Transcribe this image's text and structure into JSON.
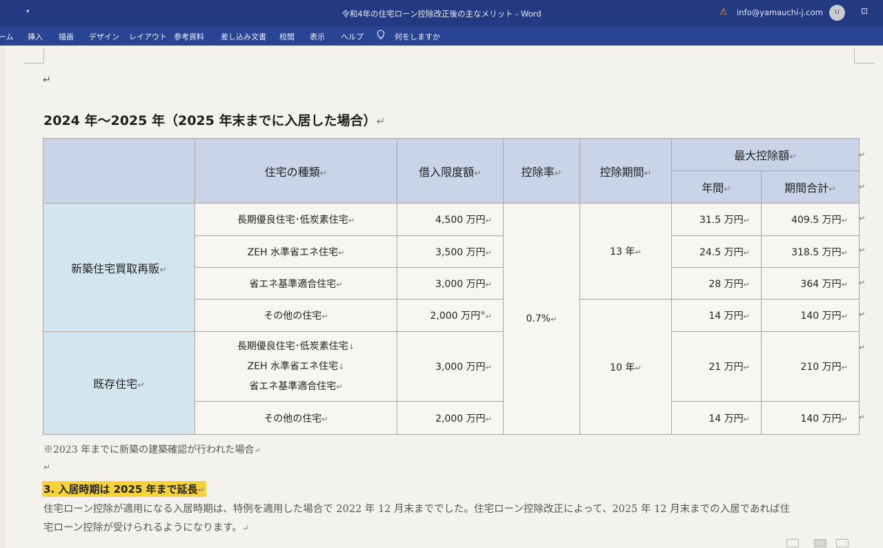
{
  "titlebar": {
    "quick_access": "▾",
    "title": "令和4年の住宅ローン控除改正後の主なメリット  -  Word",
    "account": "info@yamauchi-j.com",
    "avatar": "U"
  },
  "ribbon": {
    "tabs": [
      "ーム",
      "挿入",
      "描画",
      "デザイン",
      "レイアウト",
      "参考資料",
      "差し込み文書",
      "校閲",
      "表示",
      "ヘルプ"
    ],
    "tell_me": "何をしますか"
  },
  "document": {
    "heading": "2024 年〜2025 年（2025 年末までに入居した場合）",
    "table": {
      "headers": {
        "type": "住宅の種類",
        "limit": "借入限度額",
        "rate": "控除率",
        "period": "控除期間",
        "max": "最大控除額",
        "annual": "年間",
        "total": "期間合計"
      },
      "groups": {
        "new": "新築住宅買取再販",
        "existing": "既存住宅"
      },
      "rate_value": "0.7%",
      "period_13": "13 年",
      "period_10": "10 年",
      "rows": [
        {
          "type": "長期優良住宅･低炭素住宅",
          "limit": "4,500 万円",
          "annual": "31.5 万円",
          "total": "409.5 万円"
        },
        {
          "type": "ZEH 水準省エネ住宅",
          "limit": "3,500 万円",
          "annual": "24.5 万円",
          "total": "318.5 万円"
        },
        {
          "type": "省エネ基準適合住宅",
          "limit": "3,000 万円",
          "annual": "28 万円",
          "total": "364 万円"
        },
        {
          "type": "その他の住宅",
          "limit": "2,000 万円",
          "limit_note": "※",
          "annual": "14 万円",
          "total": "140 万円"
        },
        {
          "type_lines": [
            "長期優良住宅･低炭素住宅",
            "ZEH 水準省エネ住宅",
            "省エネ基準適合住宅"
          ],
          "limit": "3,000 万円",
          "annual": "21 万円",
          "total": "210 万円"
        },
        {
          "type": "その他の住宅",
          "limit": "2,000 万円",
          "annual": "14 万円",
          "total": "140 万円"
        }
      ]
    },
    "note": "※2023 年までに新築の建築確認が行われた場合",
    "section_title": "3. 入居時期は 2025 年まで延長",
    "body_line1": "住宅ローン控除が適用になる入居時期は、特例を適用した場合で 2022 年 12 月末まででした。住宅ローン控除改正によって、2025 年 12 月末までの入居であれば住",
    "body_line2": "宅ローン控除が受けられるようになります。"
  },
  "icons": {
    "warning": "warning-icon",
    "lightbulb": "lightbulb-icon",
    "paragraph_mark": "↵"
  },
  "colors": {
    "titlebar": "#233a82",
    "ribbon": "#2a4494",
    "table_header": "#c9d4e8",
    "row_header": "#d3e5ee",
    "highlight": "#f6d33a"
  }
}
